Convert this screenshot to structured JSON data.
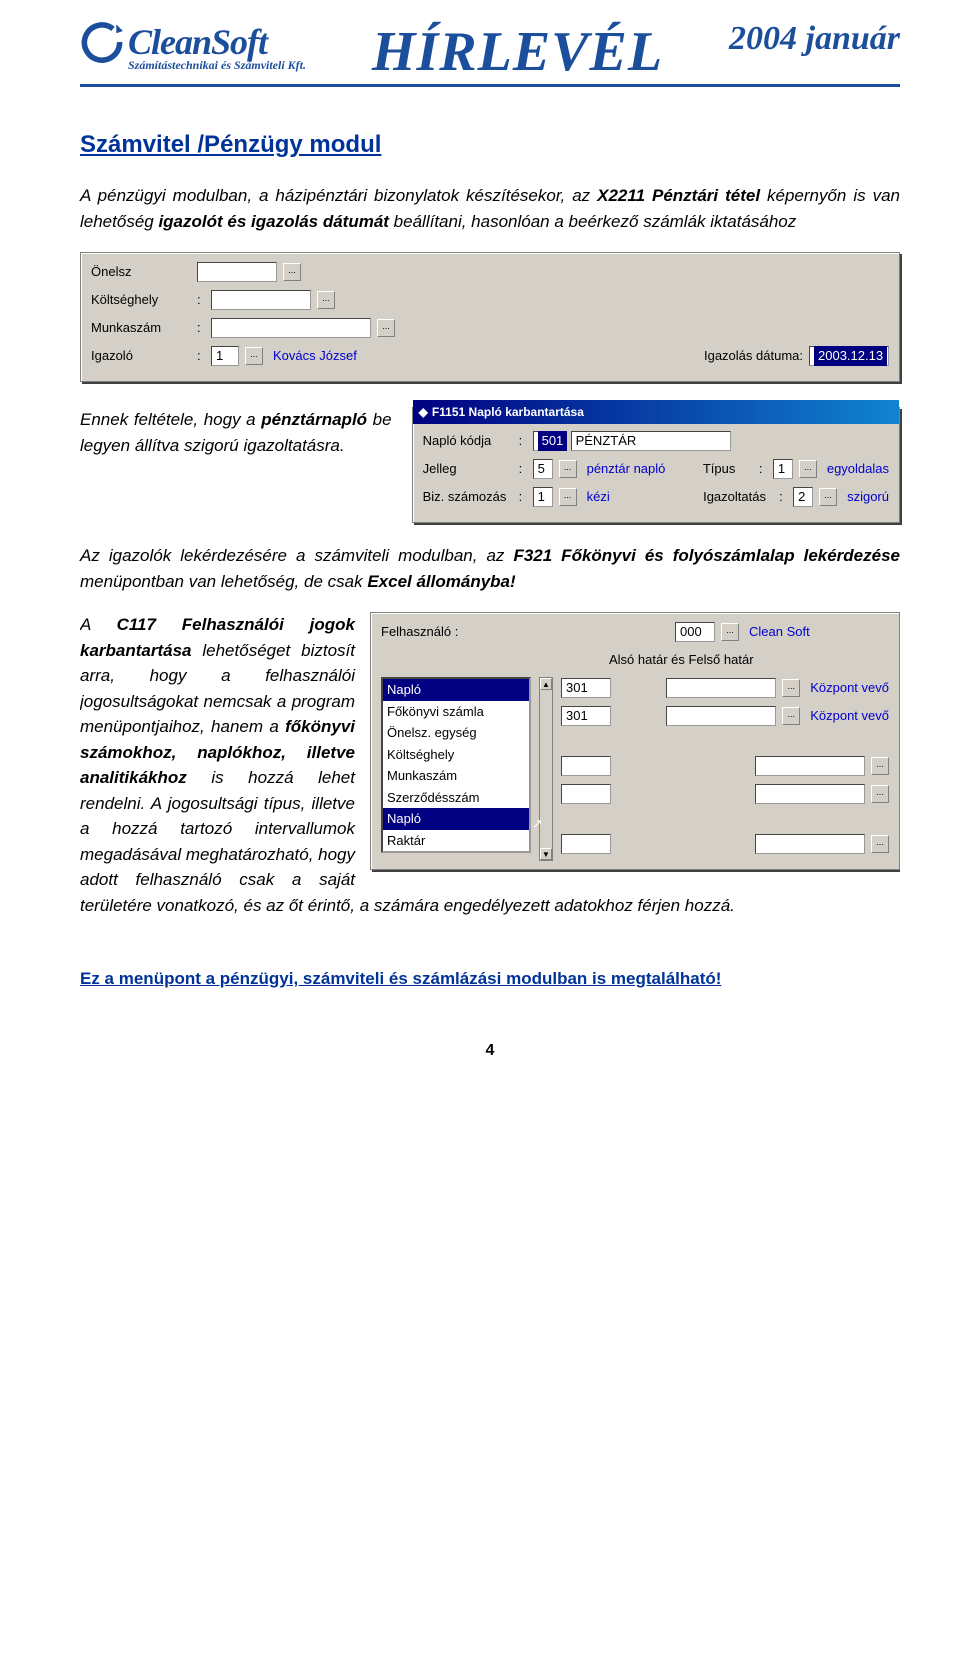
{
  "header": {
    "logoName": "CleanSoft",
    "logoSub": "Számítástechnikai és Számviteli Kft.",
    "title": "HÍRLEVÉL",
    "date": "2004 január"
  },
  "section": {
    "title": "Számvitel /Pénzügy modul",
    "p1_a": "A pénzügyi modulban, a házipénztári bizonylatok készítésekor, az ",
    "p1_b": "X2211 Pénztári tétel",
    "p1_c": " képernyőn is van lehetőség ",
    "p1_d": "igazolót és igazolás dátumát",
    "p1_e": " beállítani, hasonlóan a beérkező számlák iktatásához",
    "p2_a": "Ennek feltétele, hogy a ",
    "p2_b": "pénztárnapló",
    "p2_c": " be legyen állítva szigorú igazoltatásra.",
    "p3_a": "Az igazolók lekérdezésére a számviteli modulban, az ",
    "p3_b": "F321 Főkönyvi és folyószámlalap lekérdezése",
    "p3_c": " menüpontban van lehetőség, de csak ",
    "p3_d": "Excel állományba!",
    "p4_a": "A ",
    "p4_b": "C117 Felhasználói jogok karbantartása",
    "p4_c": " lehetőséget biztosít arra, hogy a felhasználói jogosultságokat nemcsak a program menüpontjaihoz, hanem a ",
    "p4_d": "főkönyvi számokhoz, naplókhoz, illetve analitikákhoz",
    "p4_e": " is hozzá lehet rendelni. A jogosultsági típus, illetve a hozzá tartozó intervallumok megadásával meghatározható, hogy adott felhasználó csak a saját területére vonatkozó, és az őt érintő, a számára engedélyezett adatokhoz férjen hozzá.",
    "note": "Ez a menüpont a pénzügyi, számviteli és számlázási modulban is megtalálható!"
  },
  "form1": {
    "r1": "Önelsz",
    "r2": "Költséghely",
    "r3": "Munkaszám",
    "r4": "Igazoló",
    "r4_val": "1",
    "r4_name": "Kovács József",
    "r5": "Igazolás dátuma:",
    "r5_val": "2003.12.13"
  },
  "form2": {
    "title": "F1151 Napló karbantartása",
    "l1": "Napló kódja",
    "l1v1": "501",
    "l1v2": "PÉNZTÁR",
    "l2": "Jelleg",
    "l2v1": "5",
    "l2v2": "pénztár napló",
    "l2r": "Típus",
    "l2rv1": "1",
    "l2rv2": "egyoldalas",
    "l3": "Biz. számozás",
    "l3v1": "1",
    "l3v2": "kézi",
    "l3r": "Igazoltatás",
    "l3rv1": "2",
    "l3rv2": "szigorú"
  },
  "form3": {
    "h1": "Felhasználó :",
    "h1v": "000",
    "h1n": "Clean Soft",
    "h2": "Alsó határ és Felső határ",
    "items": [
      "Napló",
      "Főkönyvi számla",
      "Önelsz. egység",
      "Költséghely",
      "Munkaszám",
      "Szerződésszám",
      "Napló",
      "Raktár"
    ],
    "v1": "301",
    "n1": "Központ vevő",
    "v2": "301",
    "n2": "Központ vevő"
  },
  "pageNum": "4"
}
